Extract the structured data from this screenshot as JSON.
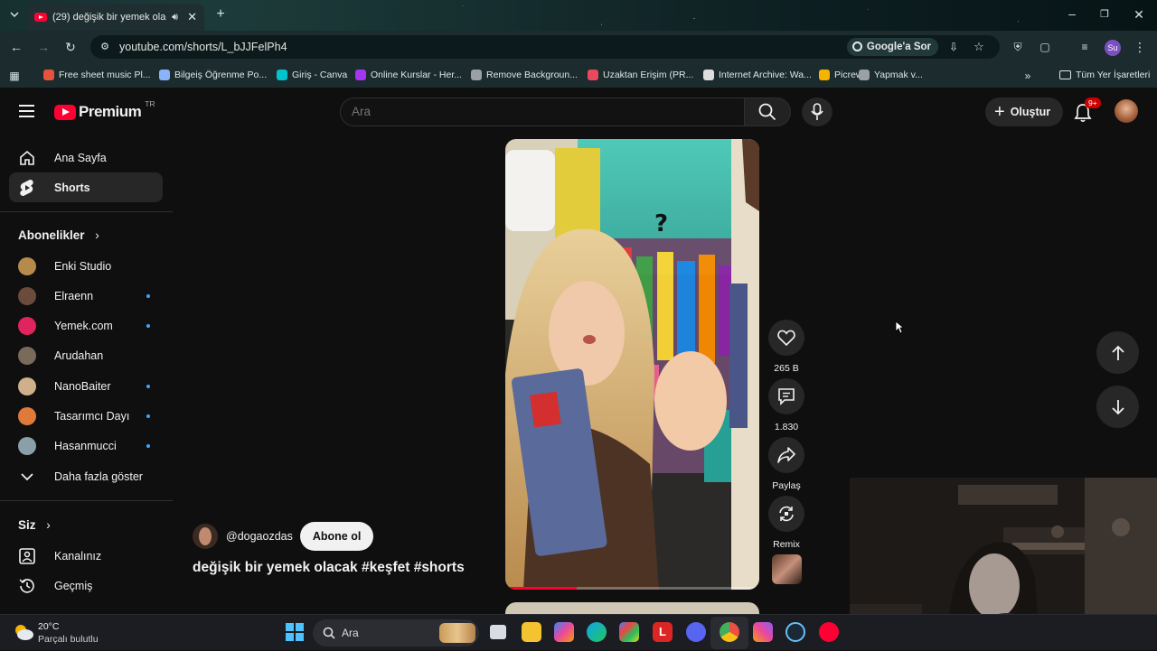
{
  "browser": {
    "tab_title": "(29) değişik bir yemek olacak #keşfet #shorts - YouTube",
    "url": "youtube.com/shorts/L_bJJFelPh4",
    "google_ask": "Google'a Sor",
    "profile_initials": "Su",
    "bookmarks": [
      {
        "label": "Free sheet music Pl...",
        "color": "#e5533d"
      },
      {
        "label": "Bilgeiş Öğrenme Po...",
        "color": "#8ab4f8"
      },
      {
        "label": "Giriş - Canva",
        "color": "#00c4cc"
      },
      {
        "label": "Online Kurslar - Her...",
        "color": "#a435f0"
      },
      {
        "label": "Remove Backgroun...",
        "color": "#9aa0a6"
      },
      {
        "label": "Uzaktan Erişim (PR...",
        "color": "#e8495c"
      },
      {
        "label": "Internet Archive: Wa...",
        "color": "#dddddd"
      },
      {
        "label": "Picrew",
        "color": "#f4b400"
      },
      {
        "label": "Yapmak v...",
        "color": "#9aa0a6"
      }
    ],
    "all_bookmarks": "Tüm Yer İşaretleri"
  },
  "youtube": {
    "logo_text": "Premium",
    "region": "TR",
    "search_placeholder": "Ara",
    "create_label": "Oluştur",
    "notif_badge": "9+"
  },
  "sidebar": {
    "main": [
      {
        "label": "Ana Sayfa",
        "icon": "home-icon"
      },
      {
        "label": "Shorts",
        "icon": "shorts-icon",
        "active": true
      }
    ],
    "subs_header": "Abonelikler",
    "subscriptions": [
      {
        "label": "Enki Studio",
        "color": "#b58a4a",
        "dot": false
      },
      {
        "label": "Elraenn",
        "color": "#6a4b3c",
        "dot": true
      },
      {
        "label": "Yemek.com",
        "color": "#e0245e",
        "dot": true
      },
      {
        "label": "Arudahan",
        "color": "#7a6a5a",
        "dot": false
      },
      {
        "label": "NanoBaiter",
        "color": "#d0b08a",
        "dot": true
      },
      {
        "label": "Tasarımcı Dayı",
        "color": "#e07a3a",
        "dot": true
      },
      {
        "label": "Hasanmucci",
        "color": "#8aa0a8",
        "dot": true
      }
    ],
    "show_more": "Daha fazla göster",
    "you_header": "Siz",
    "you_items": [
      {
        "label": "Kanalınız",
        "icon": "channel-icon"
      },
      {
        "label": "Geçmiş",
        "icon": "history-icon"
      }
    ]
  },
  "short": {
    "handle": "@dogaozdas",
    "subscribe": "Abone ol",
    "title": "değişik bir yemek olacak #keşfet #shorts",
    "likes": "265 B",
    "comments": "1.830",
    "share": "Paylaş",
    "remix": "Remix"
  },
  "taskbar": {
    "temp": "20°C",
    "weather": "Parçalı bulutlu",
    "search": "Ara"
  }
}
